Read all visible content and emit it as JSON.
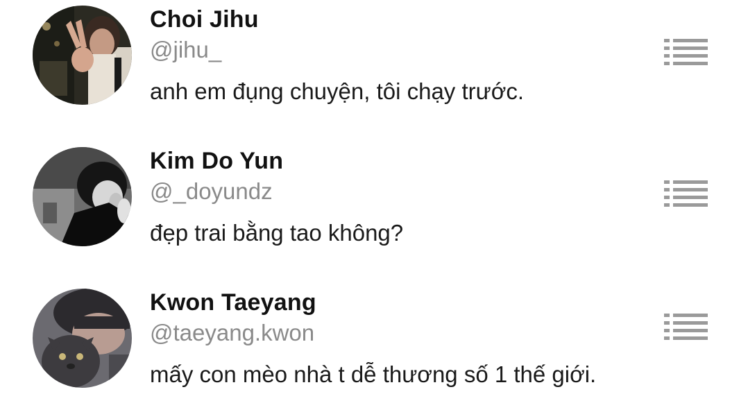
{
  "users": [
    {
      "name": "Choi Jihu",
      "handle": "@jihu_",
      "bio": "anh em đụng chuyện, tôi chạy trước.",
      "avatar_icon": "person-photo-night-icon"
    },
    {
      "name": "Kim Do Yun",
      "handle": "@_doyundz",
      "bio": "đẹp trai bằng tao không?",
      "avatar_icon": "person-photo-monochrome-icon"
    },
    {
      "name": "Kwon Taeyang",
      "handle": "@taeyang.kwon",
      "bio": "mấy con mèo nhà t dễ thương số 1 thế giới.",
      "avatar_icon": "person-with-cat-photo-icon"
    }
  ],
  "colors": {
    "name": "#111111",
    "handle": "#8a8a8a",
    "bio": "#1a1a1a",
    "menu_icon": "#9a9a9a",
    "background": "#ffffff"
  },
  "menu_icon": "list-menu-icon"
}
